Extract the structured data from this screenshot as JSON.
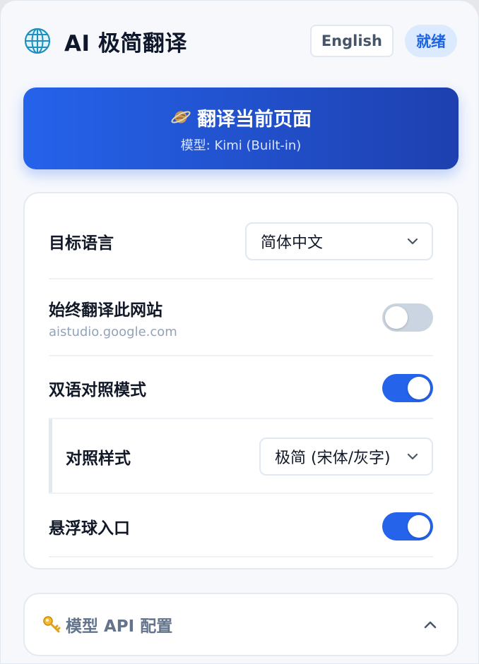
{
  "header": {
    "icon": "globe-icon",
    "title": "AI 极简翻译",
    "lang_button": "English",
    "status": "就绪"
  },
  "translate": {
    "icon": "planet-icon",
    "label": "翻译当前页面",
    "model": "模型: Kimi (Built-in)"
  },
  "settings": {
    "target_language": {
      "label": "目标语言",
      "value": "简体中文"
    },
    "always_translate": {
      "label": "始终翻译此网站",
      "site": "aistudio.google.com",
      "enabled": false
    },
    "bilingual": {
      "label": "双语对照模式",
      "enabled": true
    },
    "compare_style": {
      "label": "对照样式",
      "value": "极简 (宋体/灰字)"
    },
    "floating_ball": {
      "label": "悬浮球入口",
      "enabled": true
    }
  },
  "api_config": {
    "icon": "key-icon",
    "label": "模型 API 配置",
    "expanded": false
  },
  "colors": {
    "accent": "#2563eb",
    "accent_dark": "#1e40af",
    "status_bg": "#dbeafe",
    "toggle_off": "#cbd5e1"
  }
}
